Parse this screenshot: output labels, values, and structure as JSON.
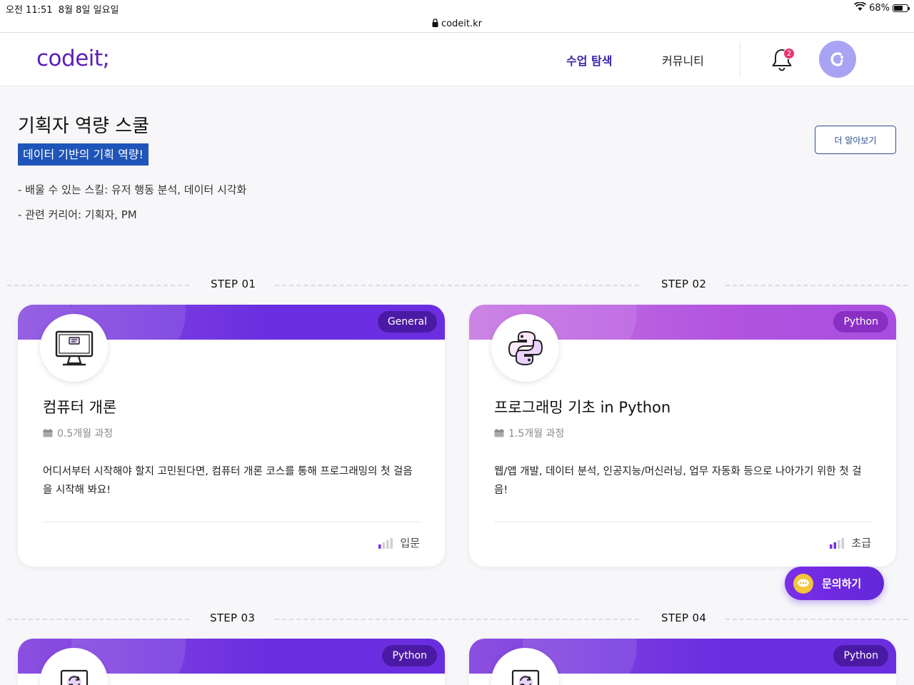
{
  "status_bar": {
    "time": "오전 11:51",
    "date": "8월 8일 일요일",
    "battery": "68%",
    "battery_level": 0.68
  },
  "url_bar": {
    "domain": "codeit.kr"
  },
  "header": {
    "logo": "codeit;",
    "nav": [
      {
        "label": "수업 탐색",
        "active": true
      },
      {
        "label": "커뮤니티",
        "active": false
      }
    ],
    "notification_count": "2"
  },
  "school": {
    "title": "기획자 역량 스쿨",
    "highlight": "데이터 기반의 기획 역량!",
    "bullets": [
      "- 배울 수 있는 스킬: 유저 행동 분석, 데이터 시각화",
      "- 관련 커리어: 기획자, PM"
    ],
    "more_button": "더 알아보기"
  },
  "steps": [
    {
      "step": "STEP 01",
      "tag": "General",
      "title": "컴퓨터 개론",
      "duration": "0.5개월 과정",
      "desc": "어디서부터 시작해야 할지 고민된다면, 컴퓨터 개론 코스를 통해 프로그래밍의 첫 걸음을 시작해 봐요!",
      "level": "입문",
      "level_bars": 1
    },
    {
      "step": "STEP 02",
      "tag": "Python",
      "title": "프로그래밍 기초 in Python",
      "duration": "1.5개월 과정",
      "desc": "웹/앱 개발, 데이터 분석, 인공지능/머신러닝, 업무 자동화 등으로 나아가기 위한 첫 걸음!",
      "level": "초급",
      "level_bars": 2
    },
    {
      "step": "STEP 03",
      "tag": "Python"
    },
    {
      "step": "STEP 04",
      "tag": "Python"
    }
  ],
  "inquiry_button": "문의하기",
  "colors": {
    "brand": "#5a1fb8",
    "nav_active": "#3d24a8",
    "highlight": "#1f55b8",
    "badge": "#e8336d"
  }
}
